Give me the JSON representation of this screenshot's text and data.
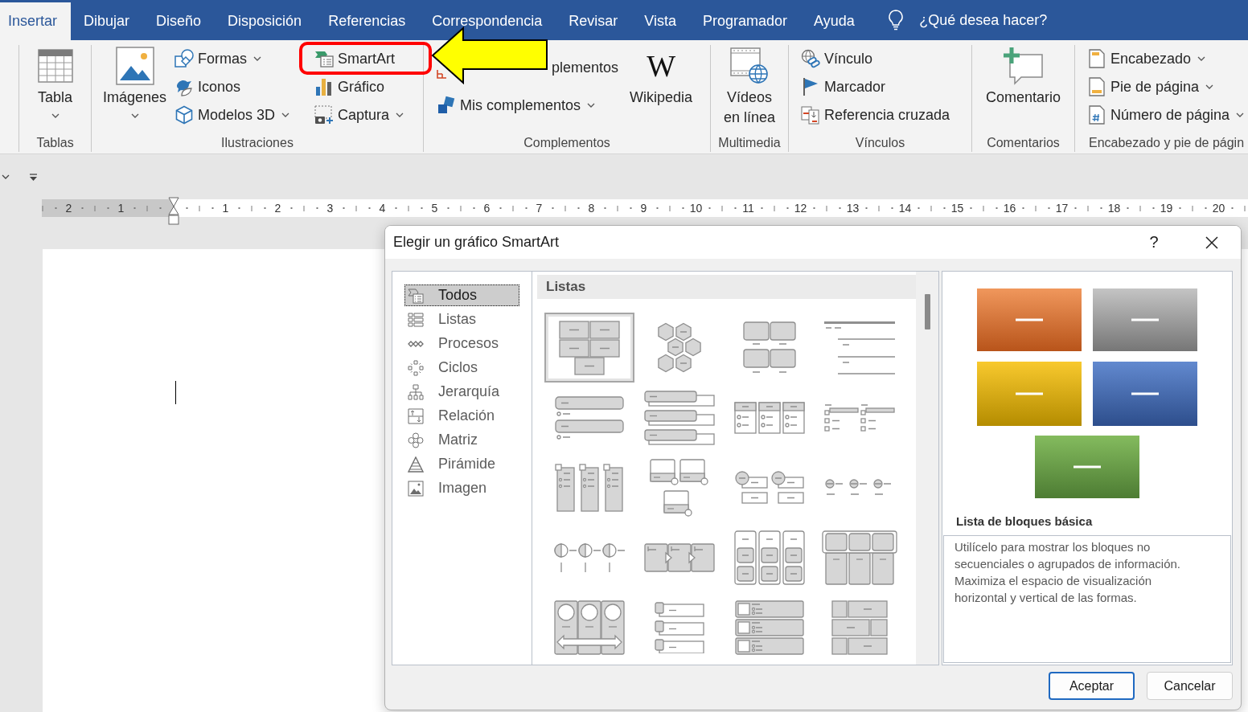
{
  "ribbon_tabs": [
    {
      "label": "Insertar",
      "selected": true
    },
    {
      "label": "Dibujar",
      "selected": false
    },
    {
      "label": "Diseño",
      "selected": false
    },
    {
      "label": "Disposición",
      "selected": false
    },
    {
      "label": "Referencias",
      "selected": false
    },
    {
      "label": "Correspondencia",
      "selected": false
    },
    {
      "label": "Revisar",
      "selected": false
    },
    {
      "label": "Vista",
      "selected": false
    },
    {
      "label": "Programador",
      "selected": false
    },
    {
      "label": "Ayuda",
      "selected": false
    }
  ],
  "tell_me": {
    "label": "¿Qué desea hacer?"
  },
  "ribbon": {
    "groups": [
      {
        "label": "Tablas",
        "columns": [
          {
            "kind": "large",
            "commands": [
              {
                "kind": "table",
                "label": "Tabla",
                "dropdown": true
              }
            ]
          }
        ]
      },
      {
        "label": "Ilustraciones",
        "columns": [
          {
            "kind": "large",
            "commands": [
              {
                "kind": "pictures",
                "label": "Imágenes",
                "dropdown": true
              }
            ]
          },
          {
            "kind": "stack",
            "commands": [
              {
                "kind": "shapes",
                "label": "Formas",
                "dropdown": true
              },
              {
                "kind": "icons",
                "label": "Iconos",
                "dropdown": false
              },
              {
                "kind": "models",
                "label": "Modelos 3D",
                "dropdown": true
              }
            ]
          },
          {
            "kind": "stack",
            "commands": [
              {
                "kind": "smartart",
                "label": "SmartArt",
                "dropdown": false
              },
              {
                "kind": "chart",
                "label": "Gráfico",
                "dropdown": false
              },
              {
                "kind": "screenshot",
                "label": "Captura",
                "dropdown": true
              }
            ]
          }
        ]
      },
      {
        "label": "Complementos",
        "columns": [
          {
            "kind": "stack",
            "commands": [
              {
                "kind": "store",
                "label": "plementos",
                "dropdown": false
              },
              {
                "kind": "addins",
                "label": "Mis complementos",
                "dropdown": true
              }
            ]
          },
          {
            "kind": "large",
            "commands": [
              {
                "kind": "wikipedia",
                "label": "Wikipedia",
                "logo": "W",
                "dropdown": false
              }
            ]
          }
        ]
      },
      {
        "label": "Multimedia",
        "columns": [
          {
            "kind": "large",
            "commands": [
              {
                "kind": "video",
                "label": "Vídeos en línea",
                "dropdown": false
              }
            ]
          }
        ]
      },
      {
        "label": "Vínculos",
        "columns": [
          {
            "kind": "stack",
            "commands": [
              {
                "kind": "link",
                "label": "Vínculo",
                "dropdown": false
              },
              {
                "kind": "bookmark",
                "label": "Marcador",
                "dropdown": false
              },
              {
                "kind": "crossref",
                "label": "Referencia cruzada",
                "dropdown": false
              }
            ]
          }
        ]
      },
      {
        "label": "Comentarios",
        "columns": [
          {
            "kind": "large",
            "commands": [
              {
                "kind": "comment",
                "label": "Comentario",
                "dropdown": false
              }
            ]
          }
        ]
      },
      {
        "label": "Encabezado y pie de págin",
        "columns": [
          {
            "kind": "stack",
            "commands": [
              {
                "kind": "header",
                "label": "Encabezado",
                "dropdown": true
              },
              {
                "kind": "footer",
                "label": "Pie de página",
                "dropdown": true
              },
              {
                "kind": "pagenumber",
                "label": "Número de página",
                "dropdown": true
              }
            ]
          }
        ]
      }
    ]
  },
  "ruler": {
    "left_numbers": [
      "2",
      "1"
    ],
    "numbers": [
      "1",
      "2",
      "3",
      "4",
      "5",
      "6",
      "7",
      "8",
      "9",
      "10",
      "11",
      "12",
      "13",
      "14",
      "15",
      "16",
      "17",
      "18",
      "19",
      "20"
    ]
  },
  "document": {
    "caret": true
  },
  "dialog": {
    "title": "Elegir un gráfico SmartArt",
    "help": "?",
    "categories": [
      {
        "kind": "all",
        "label": "Todos",
        "selected": true
      },
      {
        "kind": "list",
        "label": "Listas",
        "selected": false
      },
      {
        "kind": "process",
        "label": "Procesos",
        "selected": false
      },
      {
        "kind": "cycle",
        "label": "Ciclos",
        "selected": false
      },
      {
        "kind": "hierarchy",
        "label": "Jerarquía",
        "selected": false
      },
      {
        "kind": "relationship",
        "label": "Relación",
        "selected": false
      },
      {
        "kind": "matrix",
        "label": "Matriz",
        "selected": false
      },
      {
        "kind": "pyramid",
        "label": "Pirámide",
        "selected": false
      },
      {
        "kind": "picture",
        "label": "Imagen",
        "selected": false
      }
    ],
    "gallery": {
      "heading": "Listas",
      "items": [
        {
          "kind": "blocks",
          "selected": true
        },
        {
          "kind": "hexagons",
          "selected": false
        },
        {
          "kind": "tiles",
          "selected": false
        },
        {
          "kind": "lines",
          "selected": false
        },
        {
          "kind": "bars",
          "selected": false
        },
        {
          "kind": "stacked",
          "selected": false
        },
        {
          "kind": "tables",
          "selected": false
        },
        {
          "kind": "checklist",
          "selected": false
        },
        {
          "kind": "columns",
          "selected": false
        },
        {
          "kind": "cards",
          "selected": false
        },
        {
          "kind": "bubbles",
          "selected": false
        },
        {
          "kind": "beads",
          "selected": false
        },
        {
          "kind": "halfcircles",
          "selected": false
        },
        {
          "kind": "chevrons",
          "selected": false
        },
        {
          "kind": "stacks",
          "selected": false
        },
        {
          "kind": "panels",
          "selected": false
        },
        {
          "kind": "arrows",
          "selected": false
        },
        {
          "kind": "tabs",
          "selected": false
        },
        {
          "kind": "rows",
          "selected": false
        },
        {
          "kind": "bricks",
          "selected": false
        }
      ]
    },
    "preview": {
      "title": "Lista de bloques básica",
      "description": "Utilícelo para mostrar los bloques no secuenciales o agrupados de información. Maximiza el espacio de visualización horizontal y vertical de las formas."
    },
    "buttons": [
      {
        "label": "Aceptar",
        "default": true
      },
      {
        "label": "Cancelar",
        "default": false
      }
    ]
  },
  "callouts": [
    {
      "kind": "frame"
    },
    {
      "kind": "arrow"
    }
  ]
}
